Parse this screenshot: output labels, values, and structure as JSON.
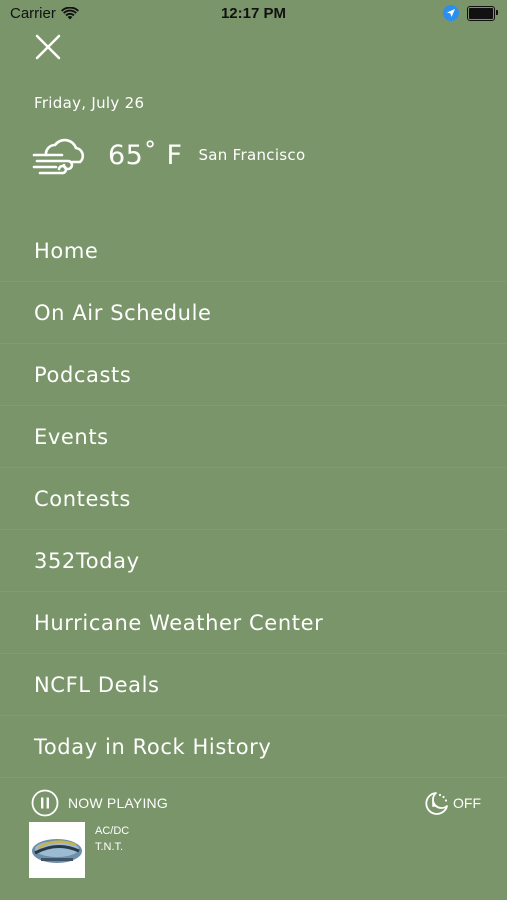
{
  "status_bar": {
    "carrier": "Carrier",
    "time": "12:17 PM"
  },
  "header": {
    "date": "Friday, July 26",
    "weather": {
      "temperature": "65˚ F",
      "city": "San Francisco",
      "icon": "wind-cloud-icon"
    }
  },
  "menu": {
    "items": [
      {
        "label": "Home"
      },
      {
        "label": "On Air Schedule"
      },
      {
        "label": "Podcasts"
      },
      {
        "label": "Events"
      },
      {
        "label": "Contests"
      },
      {
        "label": "352Today"
      },
      {
        "label": "Hurricane Weather Center"
      },
      {
        "label": "NCFL Deals"
      },
      {
        "label": "Today in Rock History"
      }
    ]
  },
  "player": {
    "now_playing_label": "NOW PLAYING",
    "sleep_label": "OFF",
    "artist": "AC/DC",
    "track": "T.N.T."
  },
  "colors": {
    "background": "#7a956a",
    "text": "#ffffff",
    "location_badge": "#2b8ff0"
  }
}
